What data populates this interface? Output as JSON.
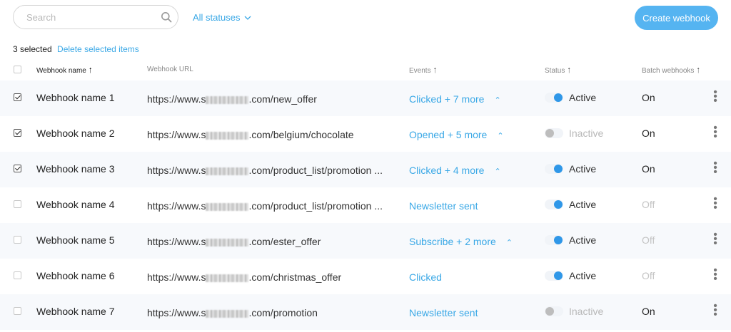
{
  "toolbar": {
    "search_placeholder": "Search",
    "status_filter": "All statuses",
    "create_button": "Create webhook"
  },
  "selection": {
    "count_label": "3 selected",
    "delete_label": "Delete selected items"
  },
  "columns": {
    "name": "Webhook name",
    "url": "Webhook URL",
    "events": "Events",
    "status": "Status",
    "batch": "Batch webhooks"
  },
  "colors": {
    "accent": "#3aa8e6",
    "button": "#55b4f1",
    "toggle_on": "#2f97e8"
  },
  "rows": [
    {
      "checked": true,
      "name": "Webhook name 1",
      "url_prefix": "https://www.s",
      "url_suffix": ".com/new_offer",
      "events": "Clicked + 7 more",
      "expandable": true,
      "status_on": true,
      "status": "Active",
      "batch": "On",
      "batch_on": true
    },
    {
      "checked": true,
      "name": "Webhook name 2",
      "url_prefix": "https://www.s",
      "url_suffix": ".com/belgium/chocolate",
      "events": "Opened + 5 more",
      "expandable": true,
      "status_on": false,
      "status": "Inactive",
      "batch": "On",
      "batch_on": true
    },
    {
      "checked": true,
      "name": "Webhook name 3",
      "url_prefix": "https://www.s",
      "url_suffix": ".com/product_list/promotion ...",
      "events": "Clicked + 4 more",
      "expandable": true,
      "status_on": true,
      "status": "Active",
      "batch": "On",
      "batch_on": true
    },
    {
      "checked": false,
      "name": "Webhook name 4",
      "url_prefix": "https://www.s",
      "url_suffix": ".com/product_list/promotion ...",
      "events": "Newsletter sent",
      "expandable": false,
      "status_on": true,
      "status": "Active",
      "batch": "Off",
      "batch_on": false
    },
    {
      "checked": false,
      "name": "Webhook name 5",
      "url_prefix": "https://www.s",
      "url_suffix": ".com/ester_offer",
      "events": "Subscribe + 2 more",
      "expandable": true,
      "status_on": true,
      "status": "Active",
      "batch": "Off",
      "batch_on": false
    },
    {
      "checked": false,
      "name": "Webhook name 6",
      "url_prefix": "https://www.s",
      "url_suffix": ".com/christmas_offer",
      "events": "Clicked",
      "expandable": false,
      "status_on": true,
      "status": "Active",
      "batch": "Off",
      "batch_on": false
    },
    {
      "checked": false,
      "name": "Webhook name 7",
      "url_prefix": "https://www.s",
      "url_suffix": ".com/promotion",
      "events": "Newsletter sent",
      "expandable": false,
      "status_on": false,
      "status": "Inactive",
      "batch": "On",
      "batch_on": true
    }
  ]
}
